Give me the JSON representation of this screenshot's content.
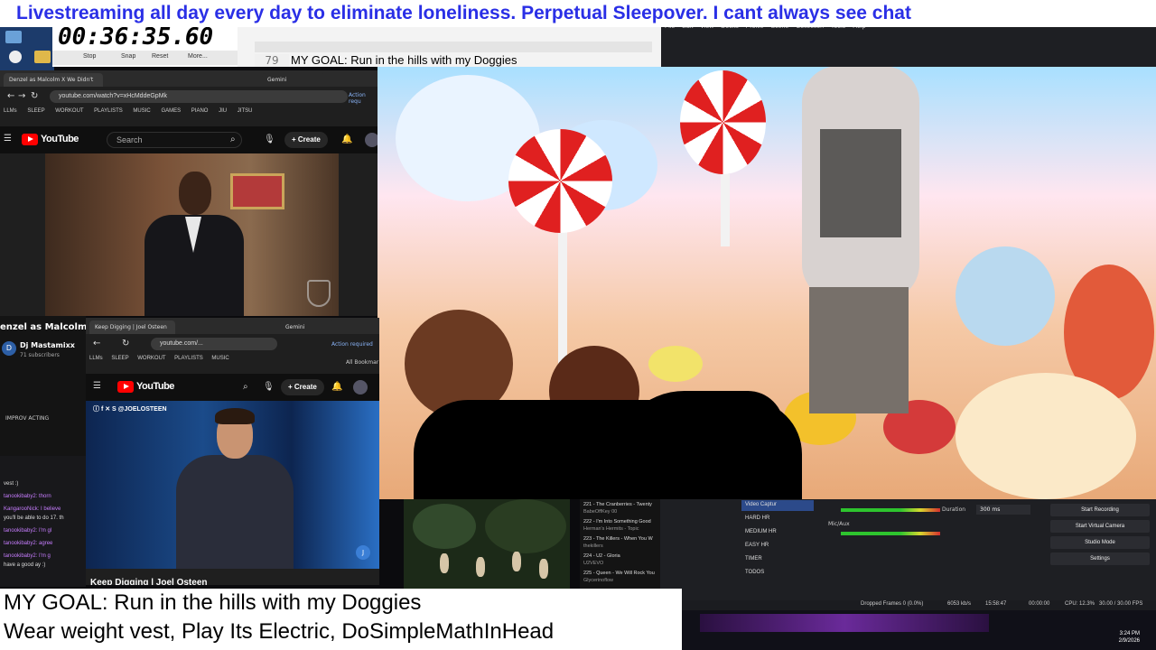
{
  "banner": {
    "text": "Livestreaming all day every day to eliminate loneliness. Perpetual Sleepover. I cant always see chat"
  },
  "timer": {
    "value": "00:36:35.60",
    "stop": "Stop",
    "snap": "Snap",
    "reset": "Reset",
    "more": "More..."
  },
  "notepad": {
    "line_number": "79",
    "goal_line": "MY GOAL: Run in the hills with my Doggies"
  },
  "obs_menu": {
    "items": [
      "File",
      "Edit",
      "View",
      "Docks",
      "Profile",
      "Scene Collection",
      "Tools",
      "Help"
    ]
  },
  "browser1": {
    "tab": "Denzel as Malcolm X We Didn't",
    "tab2": "Gemini",
    "url": "youtube.com/watch?v=xHcMddeGpMk",
    "bookmarks": [
      "LLMs",
      "SLEEP",
      "WORKOUT",
      "PLAYLISTS",
      "MUSIC",
      "GAMES",
      "PIANO",
      "JIU JITSU"
    ],
    "brand": "YouTube",
    "search_placeholder": "Search",
    "create": "Create",
    "action": "Action requ"
  },
  "channel": {
    "title_fragment": "enzel as Malcolm X",
    "name": "Dj Mastamixx",
    "subs": "71 subscribers",
    "improv": "IMPROV ACTING"
  },
  "browser2": {
    "tab": "Keep Digging | Joel Osteen",
    "tab2": "Gemini",
    "url": "youtube.com/...",
    "bookmarks": [
      "LLMs",
      "SLEEP",
      "WORKOUT",
      "PLAYLISTS",
      "MUSIC"
    ],
    "all_bookmarks": "All Bookmar",
    "action": "Action required",
    "brand": "YouTube",
    "create": "Create",
    "handle": "@JOELOSTEEN",
    "caption": "Keep Digging | Joel Osteen"
  },
  "chat": [
    {
      "text": "vest :)"
    },
    {
      "text": "tanookibaby2: thorn"
    },
    {
      "text": "KangarooNick: I believe"
    },
    {
      "text": "you'll be able to do 17. th"
    },
    {
      "text": "tanookibaby2: I'm gl"
    },
    {
      "text": "tanookibaby2: agree"
    },
    {
      "text": "tanookibaby2: I'm g"
    },
    {
      "text": "have a good ay :)"
    }
  ],
  "playlist": [
    {
      "title": "221 - The Cranberries - Twenty",
      "sub": "BabeOffKey 00"
    },
    {
      "title": "222 - I'm Into Something Good",
      "sub": "Herman's Hermits - Topic"
    },
    {
      "title": "223 - The Killers - When You W",
      "sub": "thekillers"
    },
    {
      "title": "224 - U2 - Gloria",
      "sub": "U2VEVO"
    },
    {
      "title": "225 - Queen - We Will Rock You",
      "sub": "Glycerinoflow"
    }
  ],
  "obs_sources": [
    {
      "label": "Video Captur",
      "active": true
    },
    {
      "label": "HARD HR",
      "active": false
    },
    {
      "label": "MEDIUM HR",
      "active": false
    },
    {
      "label": "EASY HR",
      "active": false
    },
    {
      "label": "TIMER",
      "active": false
    },
    {
      "label": "TODOS",
      "active": false
    }
  ],
  "obs_audio": {
    "mic": "Mic/Aux"
  },
  "obs_transition": {
    "duration_label": "Duration",
    "duration_value": "300 ms"
  },
  "obs_controls": [
    "Start Recording",
    "Start Virtual Camera",
    "Studio Mode",
    "Settings"
  ],
  "obs_status": {
    "dropped": "Dropped Frames 0 (0.0%)",
    "bitrate": "6053 kb/s",
    "live": "15:58:47",
    "rec": "00:00:00",
    "cpu": "CPU: 12.3%",
    "fps": "30.00 / 30.00 FPS"
  },
  "clock": {
    "time": "3:24 PM",
    "date": "2/9/2026"
  },
  "goal": {
    "line1": "MY GOAL: Run in the hills with my Doggies",
    "line2": "Wear weight vest, Play Its Electric, DoSimpleMathInHead"
  },
  "colors": {
    "banner_text": "#2a2fe6",
    "youtube_red": "#ff0000",
    "obs_bg": "#1e1f23"
  }
}
